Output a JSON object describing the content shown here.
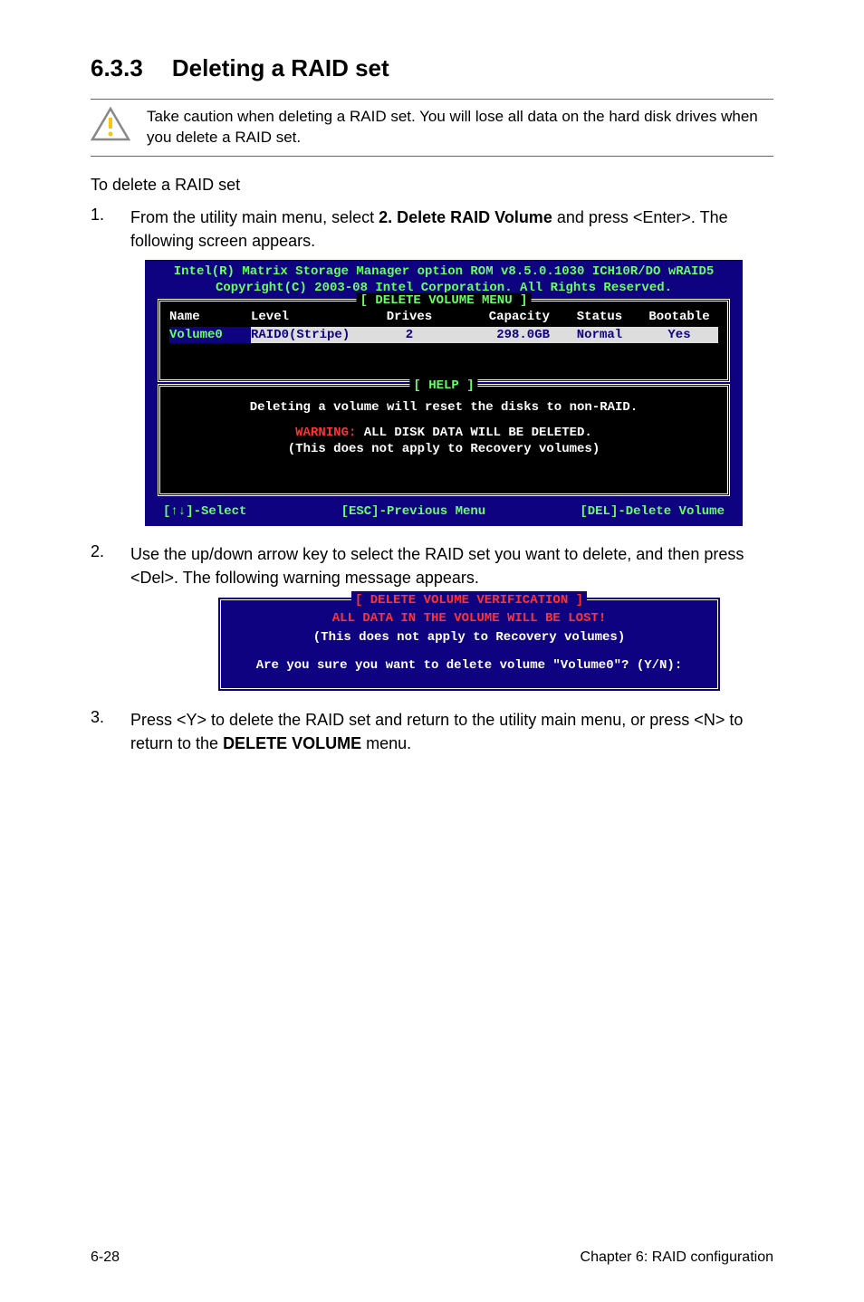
{
  "heading": {
    "number": "6.3.3",
    "title": "Deleting a RAID set"
  },
  "warning_text": "Take caution when deleting a RAID set. You will lose all data on the hard disk drives when you delete a RAID set.",
  "intro": "To delete a RAID set",
  "steps": [
    {
      "n": "1.",
      "text_pre": "From the utility main menu, select ",
      "bold": "2. Delete RAID Volume",
      "text_post": " and press <Enter>. The following screen appears."
    },
    {
      "n": "2.",
      "text": "Use the up/down arrow key to select the RAID set you want to delete, and then press <Del>. The following warning message appears."
    },
    {
      "n": "3.",
      "text_pre": "Press <Y> to delete the RAID set and return to the utility main menu, or press <N> to return to the ",
      "bold": "DELETE VOLUME",
      "text_post": " menu."
    }
  ],
  "bios": {
    "header_l1": "Intel(R) Matrix Storage Manager option ROM v8.5.0.1030 ICH10R/DO wRAID5",
    "header_l2": "Copyright(C) 2003-08 Intel Corporation.  All Rights Reserved.",
    "menu_title": "[ DELETE VOLUME MENU ]",
    "cols": {
      "name": "Name",
      "level": "Level",
      "drives": "Drives",
      "capacity": "Capacity",
      "status": "Status",
      "bootable": "Bootable"
    },
    "row": {
      "name": "Volume0",
      "level": "RAID0(Stripe)",
      "drives": "2",
      "capacity": "298.0GB",
      "status": "Normal",
      "bootable": "Yes"
    },
    "help_title": "[ HELP ]",
    "help_l1": "Deleting a volume will reset the disks to non-RAID.",
    "help_warn_label": "WARNING:",
    "help_warn_text": " ALL DISK DATA WILL BE DELETED.",
    "help_l3": "(This does not apply to Recovery volumes)",
    "footer_l": "[↑↓]-Select",
    "footer_c": "[ESC]-Previous Menu",
    "footer_r": "[DEL]-Delete Volume"
  },
  "confirm": {
    "title": "[ DELETE VOLUME VERIFICATION ]",
    "l1": "ALL DATA IN THE VOLUME WILL BE LOST!",
    "l2": "(This does not apply to Recovery volumes)",
    "l3": "Are you sure you want to delete volume \"Volume0\"? (Y/N):"
  },
  "footer": {
    "left": "6-28",
    "right": "Chapter 6: RAID configuration"
  }
}
